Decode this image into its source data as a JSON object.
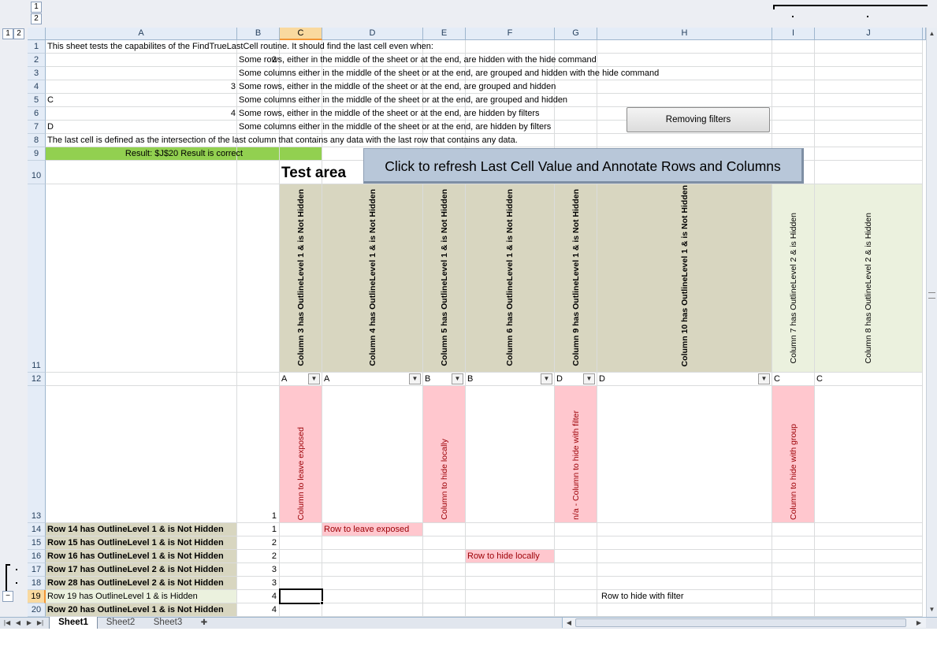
{
  "outline": {
    "row_levels": [
      "1",
      "2"
    ],
    "col_levels": [
      "1",
      "2"
    ],
    "collapse_symbol": "−"
  },
  "columns": [
    "A",
    "B",
    "C",
    "D",
    "E",
    "F",
    "G",
    "H",
    "I",
    "J"
  ],
  "rows": [
    "1",
    "2",
    "3",
    "4",
    "5",
    "6",
    "7",
    "8",
    "9",
    "10",
    "11",
    "12",
    "13",
    "14",
    "15",
    "16",
    "17",
    "18",
    "19",
    "20"
  ],
  "selected_cell": "C19",
  "cells": {
    "a1": "This sheet tests the capabilites of the FindTrueLastCell routine. It should find the last cell even when:",
    "b2": "2",
    "c2": "Some rows, either in the middle of the sheet or at the end, are hidden with the hide command",
    "c3": "Some columns either in the middle of the sheet or at the end, are grouped and hidden with the hide command",
    "b4": "3",
    "c4": "Some rows, either in the middle of the sheet or at the end, are grouped and hidden",
    "a5": "C",
    "c5": "Some columns either in the middle of the sheet or at the end, are grouped and hidden",
    "b6": "4",
    "c6": "Some rows, either in the middle of the sheet or at the end, are hidden by filters",
    "a7": "D",
    "c7": "Some columns either in the middle of the sheet or at the end, are hidden by filters",
    "a8": "The last cell is defined as the intersection of the last column that contains any data with the last row that contains any data.",
    "a9": "Result: $J$20 Result is correct",
    "c10": "Test area",
    "c11": "Column 3 has OutlineLevel 1 & is Not Hidden",
    "d11": "Column 4 has OutlineLevel 1 & is Not Hidden",
    "e11": "Column 5 has OutlineLevel 1 & is Not Hidden",
    "f11": "Column 6 has OutlineLevel 1 & is Not Hidden",
    "g11": "Column 9 has OutlineLevel 1 & is Not Hidden",
    "h11": "Column 10 has OutlineLevel 1 & is Not Hidden",
    "i11": "Column 7 has OutlineLevel 2 & is Hidden",
    "j11": "Column 8 has OutlineLevel 2 & is Hidden",
    "c12": "A",
    "d12": "A",
    "e12": "B",
    "f12": "B",
    "g12": "D",
    "h12": "D",
    "i12": "C",
    "j12": "C",
    "c13": "Column to leave exposed",
    "e13": "Column to hide locally",
    "g13": "n/a - Column to hide with filter",
    "i13": "Column to hide with group",
    "b13": "1",
    "a14": "Row 14 has OutlineLevel 1 & is Not Hidden",
    "b14": "1",
    "d14": "Row to leave exposed",
    "a15": "Row 15 has OutlineLevel 1 & is Not Hidden",
    "b15": "2",
    "a16": "Row 16 has OutlineLevel 1 & is Not Hidden",
    "b16": "2",
    "f16": "Row to hide locally",
    "a17": "Row 17 has OutlineLevel 2 & is Not Hidden",
    "b17": "3",
    "a18": "Row 28 has OutlineLevel 2 & is Not Hidden",
    "b18": "3",
    "a19": "Row 19 has OutlineLevel 1 & is Hidden",
    "b19": "4",
    "h19": "Row to hide with filter",
    "a20": "Row 20 has OutlineLevel 1 & is Not Hidden",
    "b20": "4"
  },
  "buttons": {
    "removing_filters": "Removing filters",
    "refresh": "Click to refresh Last Cell Value and Annotate Rows and Columns"
  },
  "sheets": [
    "Sheet1",
    "Sheet2",
    "Sheet3"
  ],
  "colors": {
    "result_green": "#92d050",
    "olive_header": "#d8d6c0",
    "light_green": "#ebf1de",
    "pink": "#ffc7ce",
    "pink_text": "#9c0006",
    "refresh_button": "#b8c7d9"
  }
}
